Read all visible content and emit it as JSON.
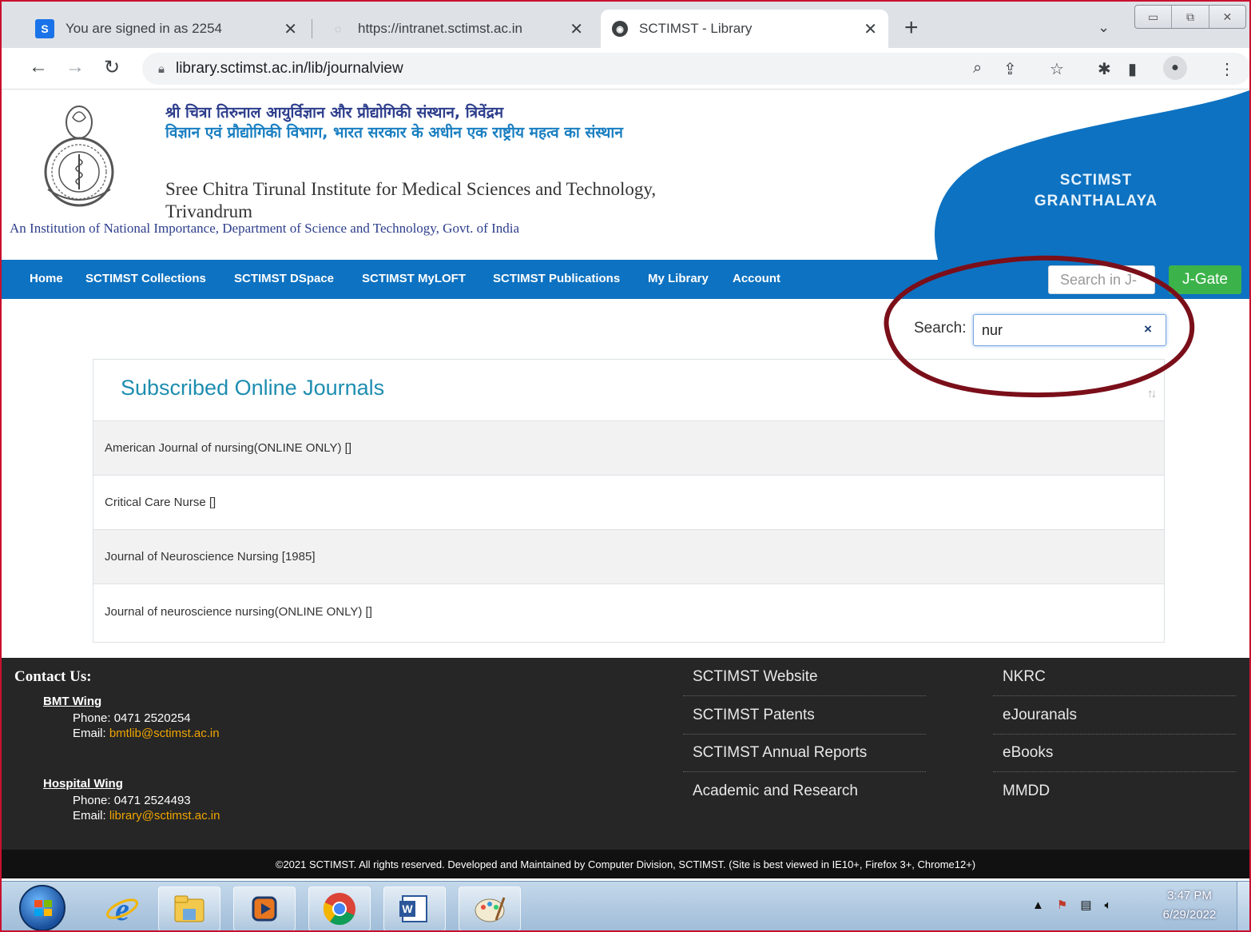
{
  "browser": {
    "tabs": [
      {
        "title": "You are signed in as 2254",
        "favicon": "S"
      },
      {
        "title": "https://intranet.sctimst.ac.in",
        "favicon": "◌"
      },
      {
        "title": "SCTIMST - Library",
        "favicon": "◉"
      }
    ],
    "url": "library.sctimst.ac.in/lib/journalview"
  },
  "header": {
    "hindi_line1": "श्री चित्रा तिरुनाल आयुर्विज्ञान और प्रौद्योगिकी संस्थान, त्रिवेंद्रम",
    "hindi_line2": "विज्ञान एवं प्रौद्योगिकी विभाग, भारत सरकार के अधीन एक राष्ट्रीय महत्व का संस्थान",
    "english_name": "Sree Chitra Tirunal Institute for Medical Sciences and Technology, Trivandrum",
    "english_sub": "An Institution of National Importance, Department of Science and Technology, Govt. of India",
    "brand_line1": "SCTIMST",
    "brand_line2": "GRANTHALAYA"
  },
  "nav": {
    "items": [
      "Home",
      "SCTIMST Collections",
      "SCTIMST DSpace",
      "SCTIMST MyLOFT",
      "SCTIMST Publications",
      "My Library",
      "Account"
    ],
    "jgate_placeholder": "Search in J-",
    "jgate_button": "J-Gate"
  },
  "search": {
    "label": "Search:",
    "value": "nur",
    "clear": "×"
  },
  "journals": {
    "title": "Subscribed Online Journals",
    "rows": [
      "American Journal of nursing(ONLINE ONLY) []",
      "Critical Care Nurse []",
      "Journal of Neuroscience Nursing [1985]",
      "Journal of neuroscience nursing(ONLINE ONLY) []"
    ]
  },
  "footer": {
    "contact_title": "Contact Us:",
    "bmt": {
      "name": "BMT Wing",
      "phone": "Phone: 0471 2520254",
      "email_label": "Email: ",
      "email": "bmtlib@sctimst.ac.in"
    },
    "hospital": {
      "name": "Hospital Wing",
      "phone": "Phone: 0471 2524493",
      "email_label": "Email: ",
      "email": "library@sctimst.ac.in"
    },
    "links_col1": [
      "SCTIMST Website",
      "SCTIMST Patents",
      "SCTIMST Annual Reports",
      "Academic and Research"
    ],
    "links_col2": [
      "NKRC",
      "eJouranals",
      "eBooks",
      "MMDD"
    ],
    "copyright": "©2021 SCTIMST. All rights reserved. Developed and Maintained by Computer Division, SCTIMST. (Site is best viewed in IE10+, Firefox 3+, Chrome12+)"
  },
  "taskbar": {
    "time": "3:47 PM",
    "date": "6/29/2022"
  },
  "colors": {
    "nav_blue": "#0d72c1",
    "jgate_green": "#3cb34a",
    "title_teal": "#1e8db0",
    "annotation": "#7a0f1a"
  }
}
